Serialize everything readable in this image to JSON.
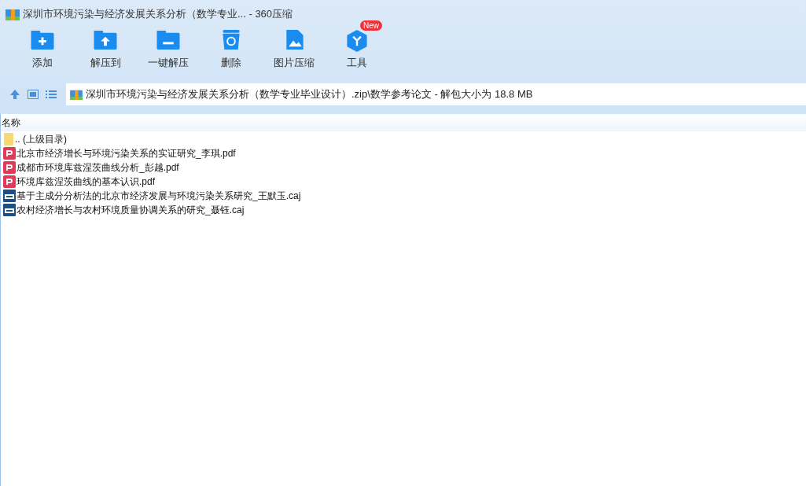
{
  "window": {
    "title": "深圳市环境污染与经济发展关系分析（数学专业... - 360压缩"
  },
  "toolbar": [
    {
      "kind": "add",
      "label": "添加"
    },
    {
      "kind": "extract-to",
      "label": "解压到"
    },
    {
      "kind": "extract",
      "label": "一键解压"
    },
    {
      "kind": "delete",
      "label": "删除"
    },
    {
      "kind": "image",
      "label": "图片压缩"
    },
    {
      "kind": "tools",
      "label": "工具",
      "badge": "New"
    }
  ],
  "path": "深圳市环境污染与经济发展关系分析（数学专业毕业设计）.zip\\数学参考论文 - 解包大小为 18.8 MB",
  "list": {
    "columns": [
      "名称"
    ],
    "rows": [
      {
        "kind": "folder",
        "name": ".. (上级目录)"
      },
      {
        "kind": "pdf",
        "name": "北京市经济增长与环境污染关系的实证研究_李琪.pdf"
      },
      {
        "kind": "pdf",
        "name": "成都市环境库兹涅茨曲线分析_彭越.pdf"
      },
      {
        "kind": "pdf",
        "name": "环境库兹涅茨曲线的基本认识.pdf"
      },
      {
        "kind": "caj",
        "name": "基于主成分分析法的北京市经济发展与环境污染关系研究_王默玉.caj"
      },
      {
        "kind": "caj",
        "name": "农村经济增长与农村环境质量协调关系的研究_聂钰.caj"
      }
    ]
  }
}
